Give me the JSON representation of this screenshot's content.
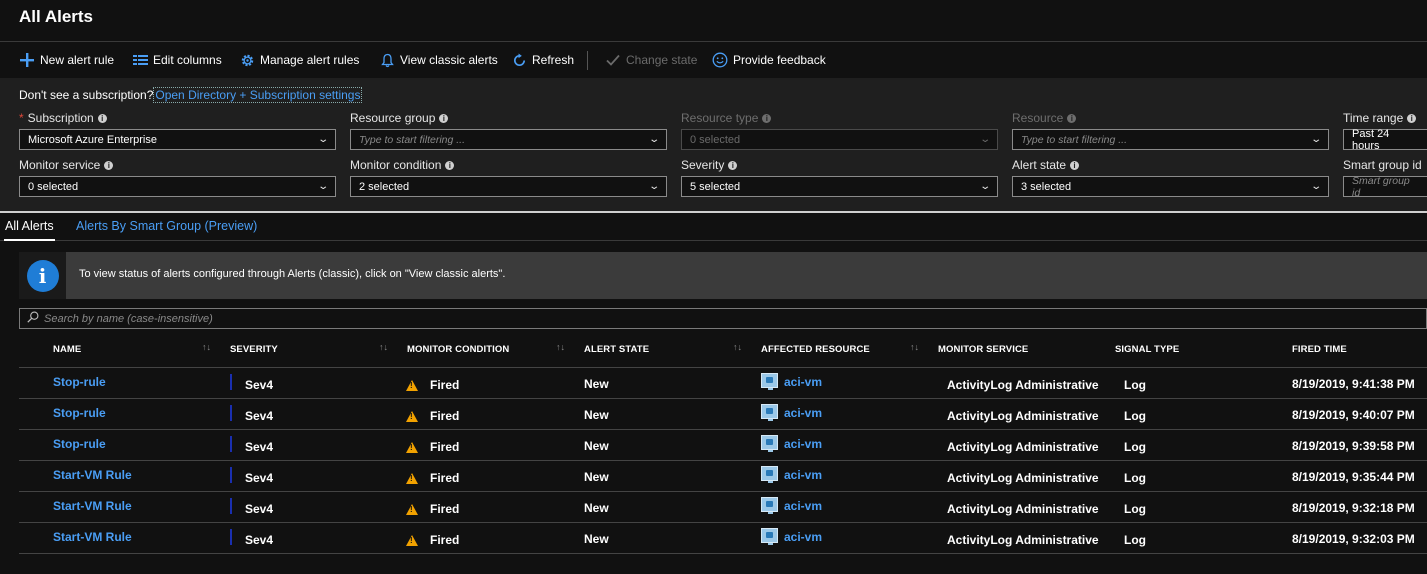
{
  "page": {
    "title": "All Alerts"
  },
  "toolbar": {
    "new_alert_rule": "New alert rule",
    "edit_columns": "Edit columns",
    "manage_alert_rules": "Manage alert rules",
    "view_classic_alerts": "View classic alerts",
    "refresh": "Refresh",
    "change_state": "Change state",
    "provide_feedback": "Provide feedback"
  },
  "filters": {
    "subscription_note": "Don't see a subscription?",
    "subscription_link": "Open Directory + Subscription settings",
    "subscription": {
      "label": "Subscription",
      "value": "Microsoft Azure Enterprise"
    },
    "resource_group": {
      "label": "Resource group",
      "placeholder": "Type to start filtering ..."
    },
    "resource_type": {
      "label": "Resource type",
      "value": "0 selected"
    },
    "resource": {
      "label": "Resource",
      "placeholder": "Type to start filtering ..."
    },
    "time_range": {
      "label": "Time range",
      "value": "Past 24 hours"
    },
    "monitor_service": {
      "label": "Monitor service",
      "value": "0 selected"
    },
    "monitor_condition": {
      "label": "Monitor condition",
      "value": "2 selected"
    },
    "severity": {
      "label": "Severity",
      "value": "5 selected"
    },
    "alert_state": {
      "label": "Alert state",
      "value": "3 selected"
    },
    "smart_group_id": {
      "label": "Smart group id",
      "placeholder": "Smart group id"
    }
  },
  "tabs": [
    {
      "label": "All Alerts",
      "active": true
    },
    {
      "label": "Alerts By Smart Group (Preview)",
      "active": false
    }
  ],
  "banner": {
    "text": "To view status of alerts configured through Alerts (classic), click on \"View classic alerts\"."
  },
  "search": {
    "placeholder": "Search by name (case-insensitive)"
  },
  "grid": {
    "columns": [
      "NAME",
      "SEVERITY",
      "MONITOR CONDITION",
      "ALERT STATE",
      "AFFECTED RESOURCE",
      "MONITOR SERVICE",
      "SIGNAL TYPE",
      "FIRED TIME"
    ],
    "rows": [
      {
        "name": "Stop-rule",
        "severity": "Sev4",
        "condition": "Fired",
        "state": "New",
        "resource": "aci-vm",
        "service": "ActivityLog Administrative",
        "signal": "Log",
        "fired": "8/19/2019, 9:41:38 PM"
      },
      {
        "name": "Stop-rule",
        "severity": "Sev4",
        "condition": "Fired",
        "state": "New",
        "resource": "aci-vm",
        "service": "ActivityLog Administrative",
        "signal": "Log",
        "fired": "8/19/2019, 9:40:07 PM"
      },
      {
        "name": "Stop-rule",
        "severity": "Sev4",
        "condition": "Fired",
        "state": "New",
        "resource": "aci-vm",
        "service": "ActivityLog Administrative",
        "signal": "Log",
        "fired": "8/19/2019, 9:39:58 PM"
      },
      {
        "name": "Start-VM Rule",
        "severity": "Sev4",
        "condition": "Fired",
        "state": "New",
        "resource": "aci-vm",
        "service": "ActivityLog Administrative",
        "signal": "Log",
        "fired": "8/19/2019, 9:35:44 PM"
      },
      {
        "name": "Start-VM Rule",
        "severity": "Sev4",
        "condition": "Fired",
        "state": "New",
        "resource": "aci-vm",
        "service": "ActivityLog Administrative",
        "signal": "Log",
        "fired": "8/19/2019, 9:32:18 PM"
      },
      {
        "name": "Start-VM Rule",
        "severity": "Sev4",
        "condition": "Fired",
        "state": "New",
        "resource": "aci-vm",
        "service": "ActivityLog Administrative",
        "signal": "Log",
        "fired": "8/19/2019, 9:32:03 PM"
      }
    ]
  },
  "colors": {
    "accent": "#4a9ef5",
    "background": "#111111",
    "panel": "#1f1f1f",
    "warning": "#f2a200",
    "sev4": "#1a2fb0"
  },
  "icons": [
    "plus-icon",
    "columns-icon",
    "gear-icon",
    "bell-icon",
    "refresh-icon",
    "checkmark-icon",
    "smiley-icon",
    "info-icon",
    "search-icon",
    "warning-icon",
    "vm-icon",
    "chevron-down-icon"
  ]
}
